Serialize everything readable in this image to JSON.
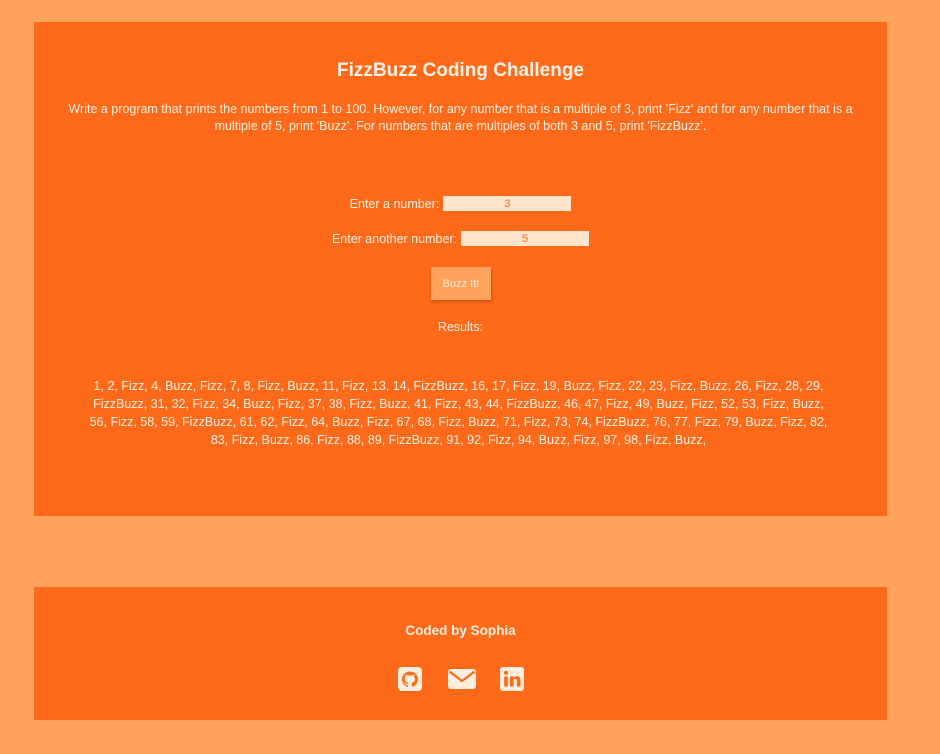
{
  "challenge": {
    "title": "FizzBuzz Coding Challenge",
    "description": "Write a program that prints the numbers from 1 to 100. However, for any number that is a multiple of 3, print 'Fizz' and for any number that is a multiple of 5, print 'Buzz'. For numbers that are multiples of both 3 and 5, print 'FizzBuzz'."
  },
  "form": {
    "first_label": "Enter a number:",
    "first_value": "3",
    "second_label": "Enter another number:",
    "second_value": "5",
    "submit_label": "Buzz It!"
  },
  "results": {
    "label": "Results:",
    "output": "1, 2, Fizz, 4, Buzz, Fizz, 7, 8, Fizz, Buzz, 11, Fizz, 13, 14, FizzBuzz, 16, 17, Fizz, 19, Buzz, Fizz, 22, 23, Fizz, Buzz, 26, Fizz, 28, 29, FizzBuzz, 31, 32, Fizz, 34, Buzz, Fizz, 37, 38, Fizz, Buzz, 41, Fizz, 43, 44, FizzBuzz, 46, 47, Fizz, 49, Buzz, Fizz, 52, 53, Fizz, Buzz, 56, Fizz, 58, 59, FizzBuzz, 61, 62, Fizz, 64, Buzz, Fizz, 67, 68, Fizz, Buzz, 71, Fizz, 73, 74, FizzBuzz, 76, 77, Fizz, 79, Buzz, Fizz, 82, 83, Fizz, Buzz, 86, Fizz, 88, 89, FizzBuzz, 91, 92, Fizz, 94, Buzz, Fizz, 97, 98, Fizz, Buzz,"
  },
  "footer": {
    "credit": "Coded by Sophia",
    "social_icons": [
      "github-icon",
      "envelope-icon",
      "linkedin-icon"
    ]
  },
  "colors": {
    "page_background": "#ffa25b",
    "panel_background": "#ff6a1a",
    "text": "#ffeede",
    "input_background": "#ffe4cc"
  }
}
